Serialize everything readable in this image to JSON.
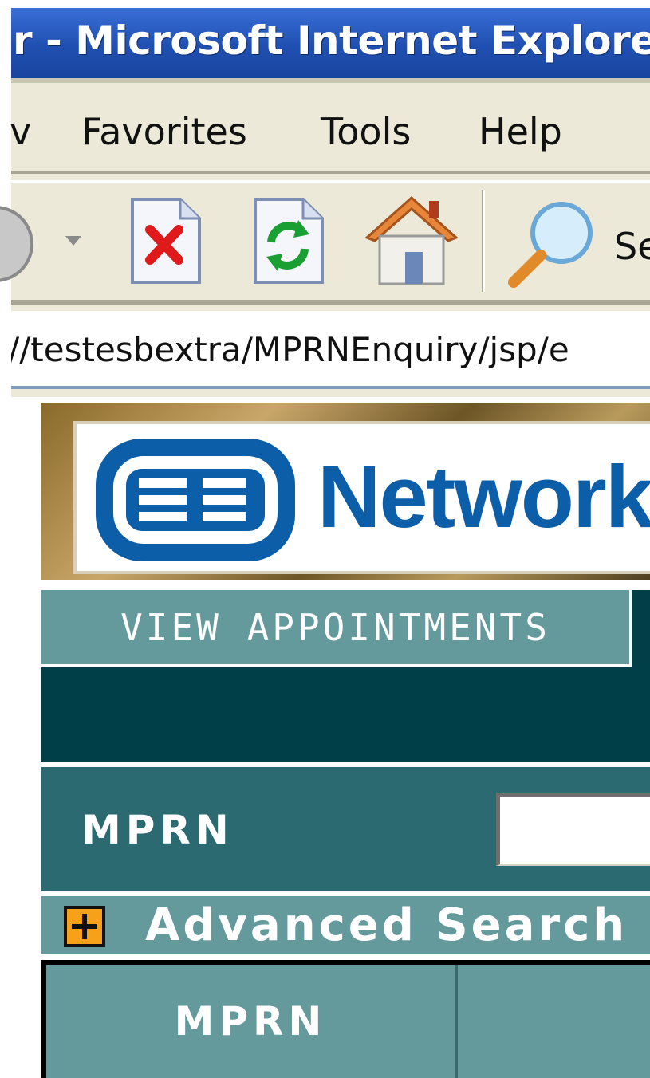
{
  "window": {
    "title": "r - Microsoft Internet Explorer"
  },
  "menu": {
    "items": [
      "v",
      "Favorites",
      "Tools",
      "Help"
    ]
  },
  "toolbar": {
    "search_label": "Se"
  },
  "address": {
    "url": "//testesbextra/MPRNEnquiry/jsp/e"
  },
  "banner": {
    "logo_text": "Network"
  },
  "nav": {
    "tab_view_appointments": "VIEW APPOINTMENTS"
  },
  "search": {
    "label": "MPRN",
    "value": ""
  },
  "advanced": {
    "label": "Advanced Search"
  },
  "results": {
    "columns": [
      "MPRN"
    ]
  },
  "colors": {
    "tab": "#649a9c",
    "dark": "#003e48",
    "search_row": "#2a6a70",
    "plus_box": "#f7a01a",
    "logo_blue": "#0d5ea8"
  }
}
